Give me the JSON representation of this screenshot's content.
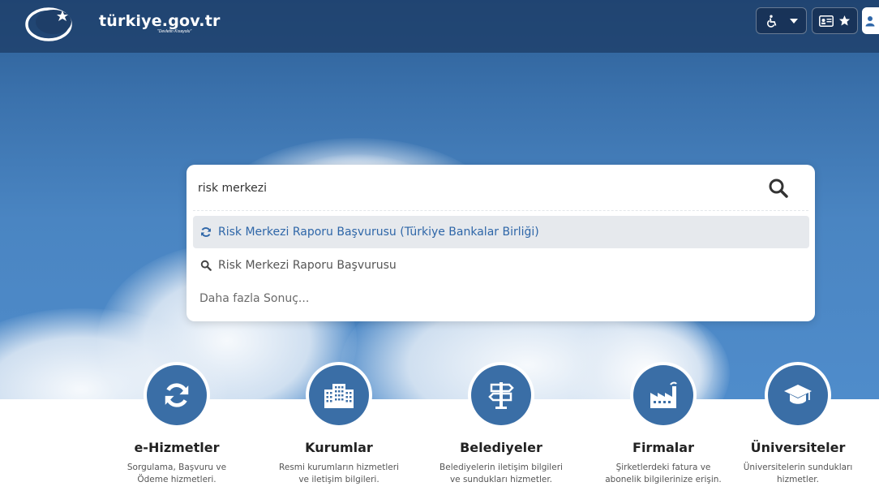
{
  "header": {
    "logo_text": "türkiye.gov.tr",
    "logo_slogan": "\"Devletin Kısayolu\""
  },
  "search": {
    "value": "risk merkezi",
    "placeholder": "",
    "icon": "search-icon",
    "suggestions": [
      {
        "label": "Risk Merkezi Raporu Başvurusu (Türkiye Bankalar Birliği)",
        "icon": "refresh-icon"
      },
      {
        "label": "Risk Merkezi Raporu Başvurusu",
        "icon": "search-icon"
      },
      {
        "label": "Daha fazla Sonuç...",
        "icon": ""
      }
    ]
  },
  "categories": [
    {
      "title": "e-Hizmetler",
      "desc": "Sorgulama, Başvuru ve Ödeme hizmetleri.",
      "icon": "refresh-icon"
    },
    {
      "title": "Kurumlar",
      "desc": "Resmi kurumların hizmetleri ve iletişim bilgileri.",
      "icon": "building-icon"
    },
    {
      "title": "Belediyeler",
      "desc": "Belediyelerin iletişim bilgileri ve sundukları hizmetler.",
      "icon": "signpost-icon"
    },
    {
      "title": "Firmalar",
      "desc": "Şirketlerdeki fatura ve abonelik bilgilerinize erişin.",
      "icon": "factory-icon"
    },
    {
      "title": "Üniversiteler",
      "desc": "Üniversitelerin sundukları hizmetler.",
      "icon": "graduation-cap-icon"
    }
  ],
  "colors": {
    "brand_blue": "#3a6ea6",
    "link_blue": "#2e66a8",
    "header_bg": "#1e3e68"
  }
}
